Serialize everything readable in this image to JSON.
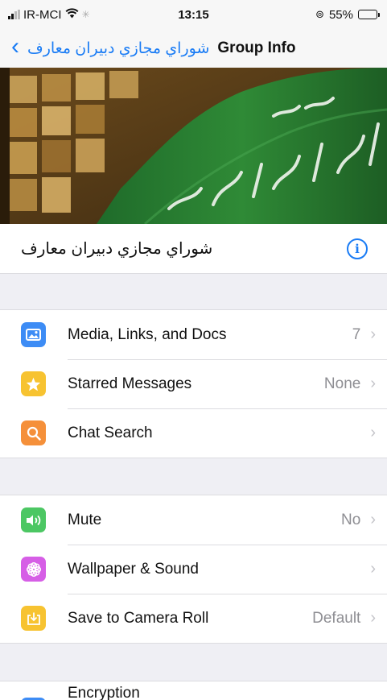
{
  "status_bar": {
    "carrier": "IR-MCI",
    "time": "13:15",
    "battery_percent": "55%",
    "battery_level": 0.55
  },
  "nav": {
    "back_title": "شوراي مجازي دبيران معارف",
    "title": "Group Info"
  },
  "group": {
    "name": "شوراي مجازي دبيران معارف"
  },
  "section1": [
    {
      "label": "Media, Links, and Docs",
      "value": "7",
      "icon": "photo-icon",
      "color": "#3d8cf5"
    },
    {
      "label": "Starred Messages",
      "value": "None",
      "icon": "star-icon",
      "color": "#f7c331"
    },
    {
      "label": "Chat Search",
      "value": "",
      "icon": "search-icon",
      "color": "#f5903a"
    }
  ],
  "section2": [
    {
      "label": "Mute",
      "value": "No",
      "icon": "speaker-icon",
      "color": "#4cc763"
    },
    {
      "label": "Wallpaper & Sound",
      "value": "",
      "icon": "flower-icon",
      "color": "#d65ee6"
    },
    {
      "label": "Save to Camera Roll",
      "value": "Default",
      "icon": "download-icon",
      "color": "#f7c331"
    }
  ],
  "section3": [
    {
      "label": "Encryption",
      "value": "",
      "icon": "lock-icon",
      "color": "#3d8cf5"
    }
  ]
}
